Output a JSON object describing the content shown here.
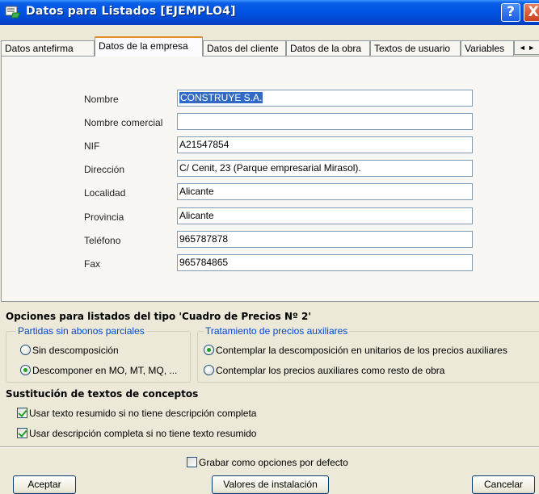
{
  "window": {
    "title": "Datos para Listados [EJEMPLO4]",
    "help_glyph": "?",
    "close_glyph": "X"
  },
  "tabs": [
    {
      "label": "Datos antefirma"
    },
    {
      "label": "Datos de la empresa"
    },
    {
      "label": "Datos del cliente"
    },
    {
      "label": "Datos de la obra"
    },
    {
      "label": "Textos de usuario"
    },
    {
      "label": "Variables"
    }
  ],
  "tab_scroll": {
    "left": "◄",
    "right": "►"
  },
  "company": {
    "fields": [
      {
        "label": "Nombre",
        "value": "CONSTRUYE S.A."
      },
      {
        "label": "Nombre comercial",
        "value": ""
      },
      {
        "label": "NIF",
        "value": "A21547854"
      },
      {
        "label": "Dirección",
        "value": "C/ Cenit, 23 (Parque empresarial Mirasol)."
      },
      {
        "label": "Localidad",
        "value": "Alicante"
      },
      {
        "label": "Provincia",
        "value": "Alicante"
      },
      {
        "label": "Teléfono",
        "value": "965787878"
      },
      {
        "label": "Fax",
        "value": "965784865"
      }
    ]
  },
  "options": {
    "title": "Opciones para listados del tipo 'Cuadro de Precios Nº 2'",
    "partidas": {
      "legend": "Partidas sin abonos parciales",
      "opt1": "Sin descomposición",
      "opt2": "Descomponer en MO, MT, MQ, ..."
    },
    "tratamiento": {
      "legend": "Tratamiento de precios auxiliares",
      "opt1": "Contemplar la descomposición en unitarios de los precios auxiliares",
      "opt2": "Contemplar los precios auxiliares como resto de obra"
    }
  },
  "substitution": {
    "title": "Sustitución de textos de conceptos",
    "check1": "Usar texto resumido si no tiene descripción completa",
    "check2": "Usar descripción completa si no tiene texto resumido"
  },
  "save_default": "Grabar como opciones por defecto",
  "buttons": {
    "accept": "Aceptar",
    "defaults": "Valores de instalación",
    "cancel": "Cancelar"
  },
  "colors": {
    "titlebar": "#0054e3",
    "legend": "#0046d5",
    "selection": "#316ac5",
    "check_mark": "#21a121"
  }
}
